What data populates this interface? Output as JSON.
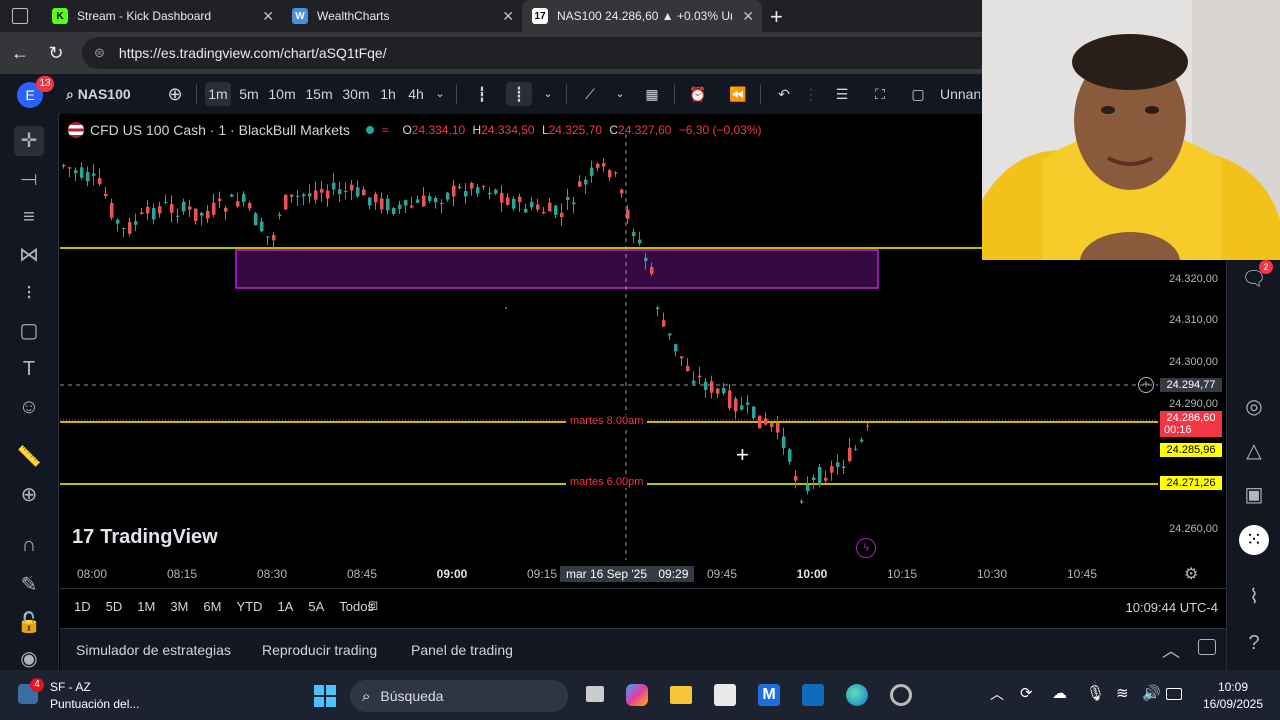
{
  "browser": {
    "tabs": [
      {
        "title": "Stream - Kick Dashboard",
        "favicon": "K",
        "color": "#53fc18"
      },
      {
        "title": "WealthCharts",
        "favicon": "W",
        "color": "#4a90e2"
      },
      {
        "title": "NAS100 24.286,60 ▲ +0.03% Unna",
        "favicon": "17",
        "color": "#ffffff"
      }
    ],
    "url": "https://es.tradingview.com/chart/aSQ1tFqe/"
  },
  "toolbar": {
    "avatar_letter": "E",
    "notif_count": "13",
    "symbol": "NAS100",
    "intervals": [
      "1m",
      "5m",
      "10m",
      "15m",
      "30m",
      "1h",
      "4h"
    ],
    "active_interval": "1m",
    "layout_name": "Unnan"
  },
  "legend": {
    "title": "CFD US 100 Cash · 1 · BlackBull Markets",
    "o_label": "O",
    "o_value": "24.334,10",
    "h_label": "H",
    "h_value": "24.334,50",
    "l_label": "L",
    "l_value": "24.325,70",
    "c_label": "C",
    "c_value": "24.327,60",
    "change": "−6,30 (−0,03%)"
  },
  "chart_data": {
    "type": "candlestick",
    "x": [
      "08:00",
      "08:15",
      "08:30",
      "08:45",
      "09:00",
      "09:15",
      "09:29",
      "09:45",
      "10:00",
      "10:15",
      "10:30",
      "10:45"
    ],
    "y_ticks": [
      "24.320,00",
      "24.310,00",
      "24.300,00",
      "24.290,00",
      "24.260,00"
    ],
    "ylim": [
      24255,
      24345
    ],
    "horizontal_lines": [
      {
        "label": "martes 8.00am",
        "price": "24.285,96"
      },
      {
        "label": "martes 6.00pm",
        "price": "24.271,26"
      }
    ],
    "crosshair_price": "24.294,77",
    "last_price": "24.286,60",
    "countdown": "00:16",
    "crosshair_time": "mar 16 Sep '25",
    "crosshair_time_right": "09:29",
    "colors": {
      "up": "#26a69a",
      "down": "#ef5350",
      "line": "#ffff00",
      "zone": "#9c27b0"
    }
  },
  "watermark": "TradingView",
  "ranges": [
    "1D",
    "5D",
    "1M",
    "3M",
    "6M",
    "YTD",
    "1A",
    "5A",
    "Todos"
  ],
  "clock": "10:09:44 UTC-4",
  "bottom_tabs": [
    "Simulador de estrategias",
    "Reproducir trading",
    "Panel de trading"
  ],
  "right_badge": "2",
  "taskbar": {
    "weather_title": "SF - AZ",
    "weather_sub": "Puntuación del...",
    "weather_badge": "4",
    "search": "Búsqueda",
    "time": "10:09",
    "date": "16/09/2025"
  }
}
